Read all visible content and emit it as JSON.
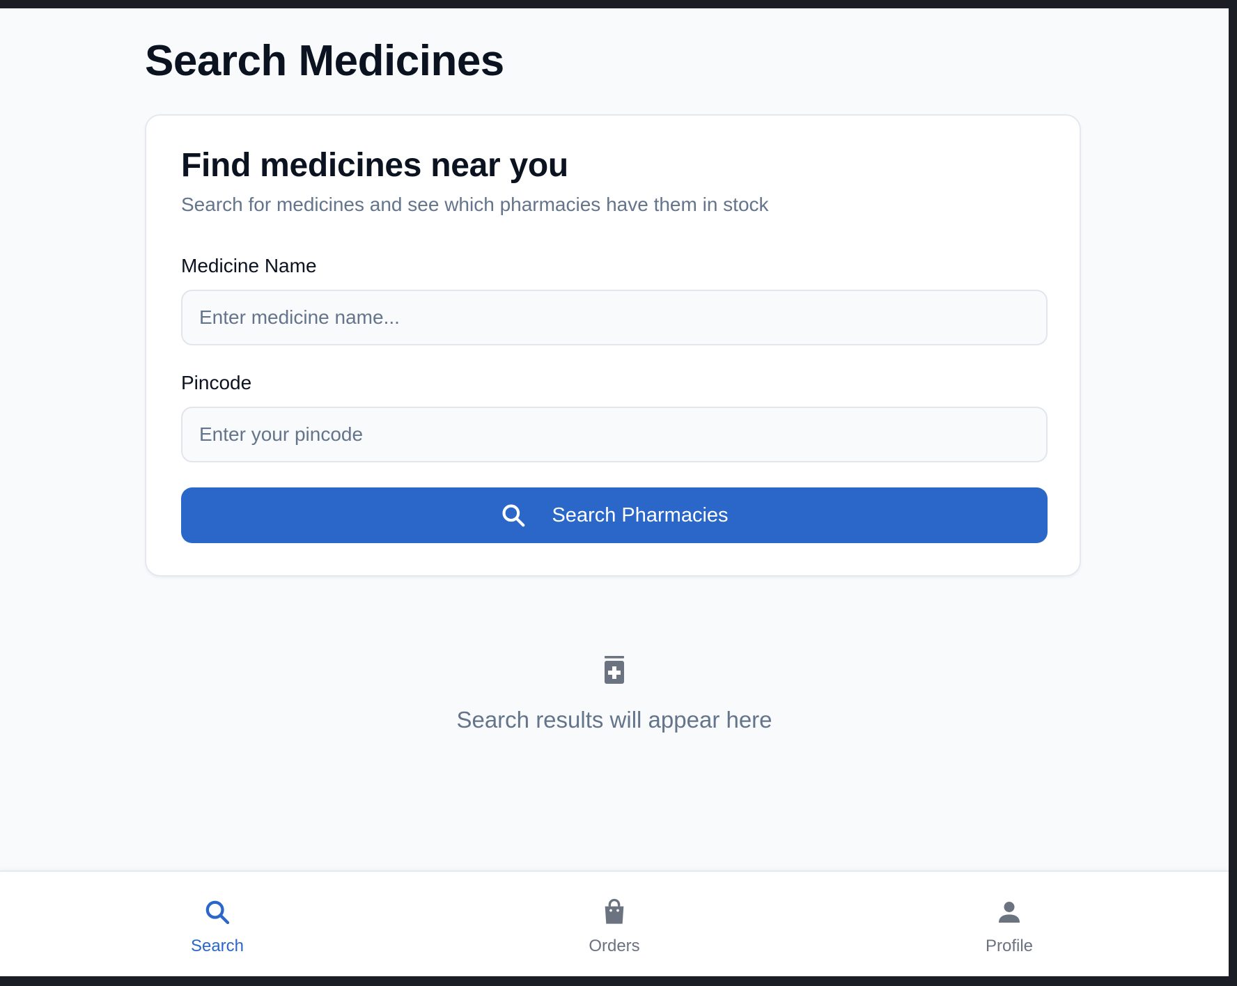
{
  "page": {
    "title": "Search Medicines"
  },
  "card": {
    "title": "Find medicines near you",
    "subtitle": "Search for medicines and see which pharmacies have them in stock",
    "medicine_label": "Medicine Name",
    "medicine_placeholder": "Enter medicine name...",
    "medicine_value": "",
    "pincode_label": "Pincode",
    "pincode_placeholder": "Enter your pincode",
    "pincode_value": "",
    "search_button_label": "Search Pharmacies",
    "search_button_icon": "search-icon"
  },
  "empty_state": {
    "icon": "medicine-bottle-icon",
    "text": "Search results will appear here"
  },
  "bottom_nav": {
    "items": [
      {
        "label": "Search",
        "icon": "search-icon",
        "active": true
      },
      {
        "label": "Orders",
        "icon": "shopping-bag-icon",
        "active": false
      },
      {
        "label": "Profile",
        "icon": "person-icon",
        "active": false
      }
    ]
  },
  "colors": {
    "accent": "#2b67c8",
    "title_text": "#0b1220",
    "muted_text": "#64748b",
    "page_background": "#f8fafc",
    "card_background": "#ffffff",
    "inactive_icon": "#6b7280"
  }
}
